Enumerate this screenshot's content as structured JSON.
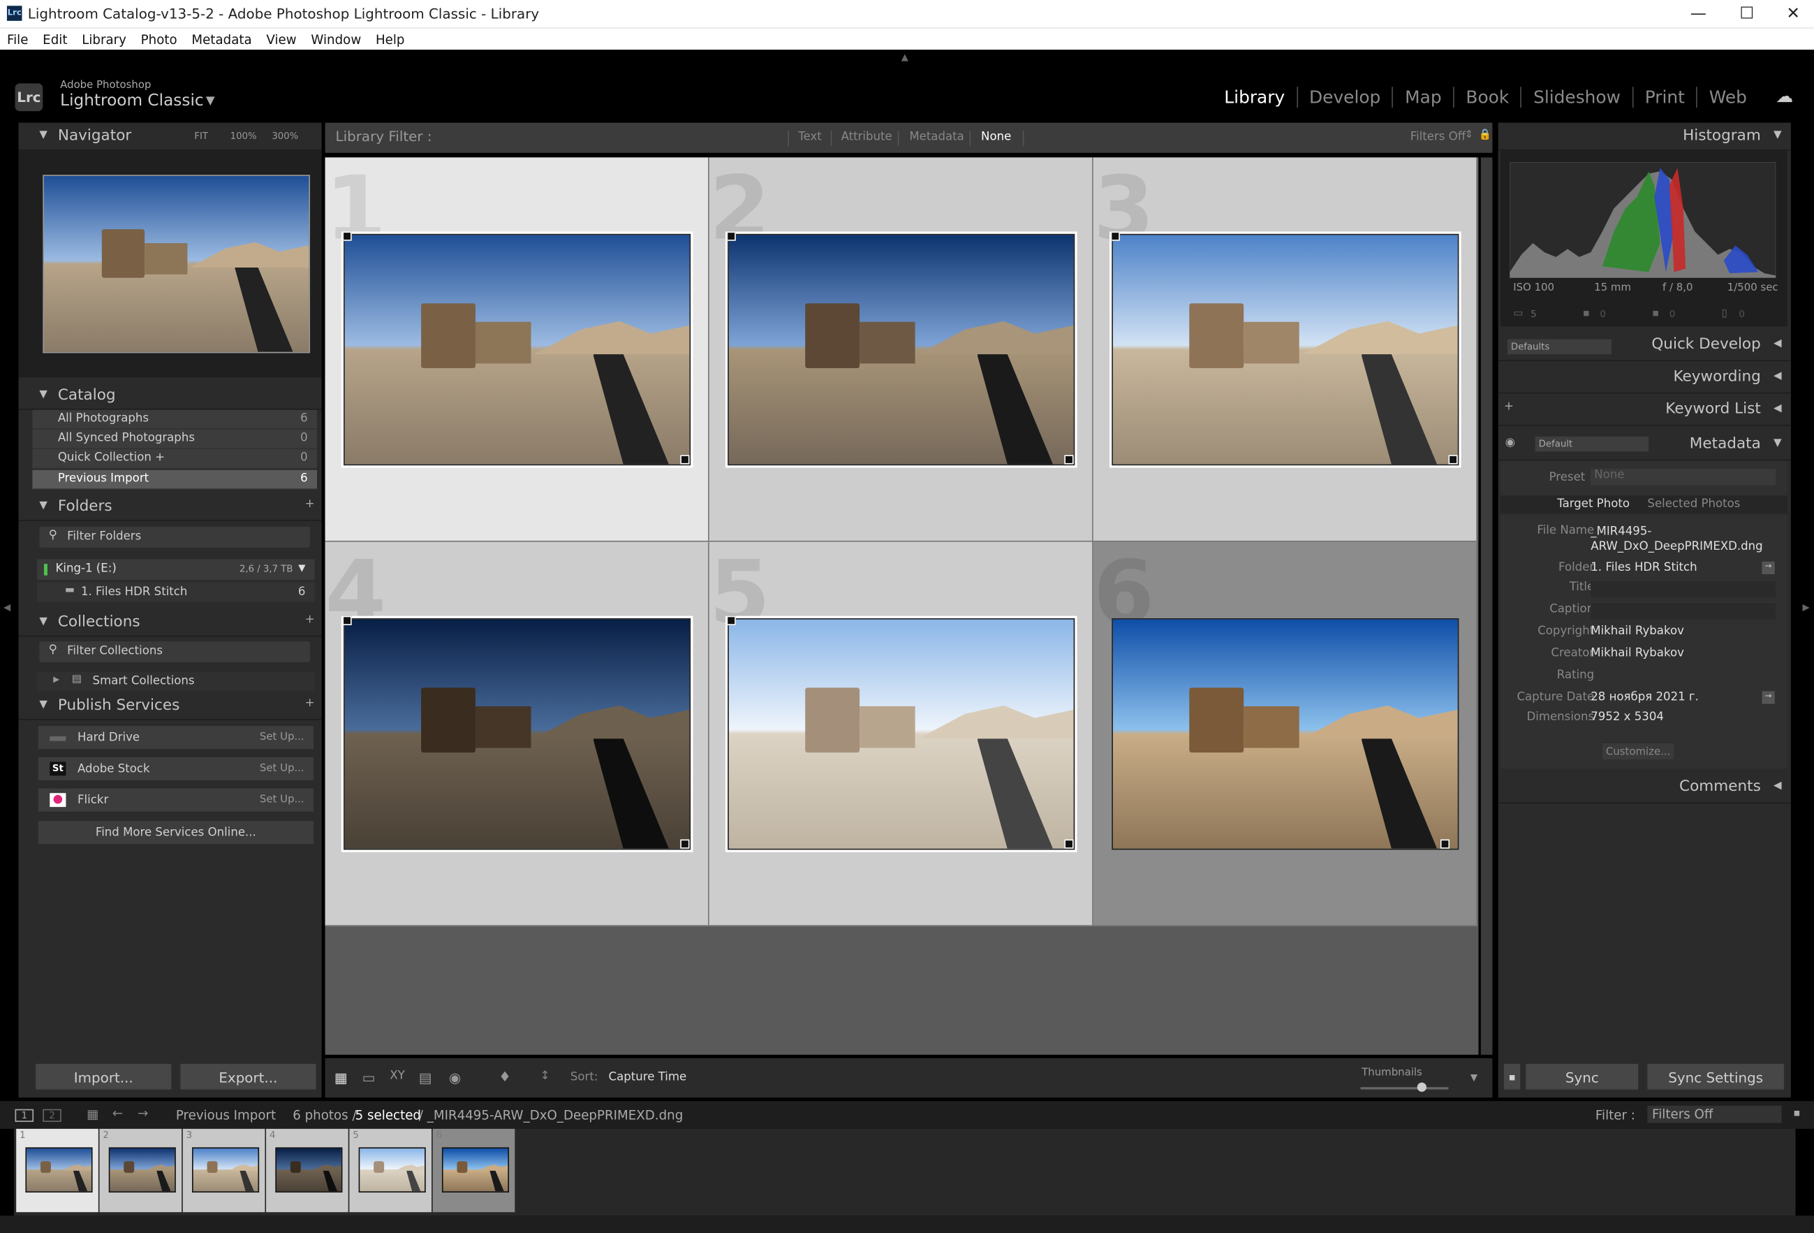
{
  "window": {
    "title": "Lightroom Catalog-v13-5-2 - Adobe Photoshop Lightroom Classic - Library",
    "app_icon_label": "Lrc",
    "minimize": "—",
    "maximize": "☐",
    "close": "✕"
  },
  "menu": [
    "File",
    "Edit",
    "Library",
    "Photo",
    "Metadata",
    "View",
    "Window",
    "Help"
  ],
  "identity": {
    "brand_top": "Adobe Photoshop",
    "brand": "Lightroom Classic",
    "logo": "Lrc"
  },
  "modules": [
    "Library",
    "Develop",
    "Map",
    "Book",
    "Slideshow",
    "Print",
    "Web"
  ],
  "navigator": {
    "title": "Navigator",
    "fit": "FIT",
    "z1": "100%",
    "z2": "300%"
  },
  "catalog": {
    "title": "Catalog",
    "items": [
      {
        "label": "All Photographs",
        "count": "6"
      },
      {
        "label": "All Synced Photographs",
        "count": "0"
      },
      {
        "label": "Quick Collection  +",
        "count": "0"
      },
      {
        "label": "Previous Import",
        "count": "6"
      }
    ]
  },
  "folders": {
    "title": "Folders",
    "filter": "Filter Folders",
    "volume": "King-1 (E:)",
    "volume_size": "2,6 / 3,7 TB",
    "folder": "1. Files HDR Stitch",
    "folder_count": "6"
  },
  "collections": {
    "title": "Collections",
    "filter": "Filter Collections",
    "smart": "Smart Collections"
  },
  "publish": {
    "title": "Publish Services",
    "items": [
      {
        "label": "Hard Drive",
        "action": "Set Up..."
      },
      {
        "label": "Adobe Stock",
        "action": "Set Up..."
      },
      {
        "label": "Flickr",
        "action": "Set Up..."
      }
    ],
    "find_more": "Find More Services Online..."
  },
  "buttons": {
    "import": "Import...",
    "export": "Export...",
    "sync": "Sync",
    "sync_settings": "Sync Settings"
  },
  "library_filter": {
    "label": "Library Filter :",
    "tabs": [
      "Text",
      "Attribute",
      "Metadata",
      "None"
    ],
    "active": "None",
    "filters_off": "Filters Off"
  },
  "grid": {
    "cells": [
      "1",
      "2",
      "3",
      "4",
      "5",
      "6"
    ]
  },
  "toolbar": {
    "sort_label": "Sort:",
    "sort_value": "Capture Time",
    "thumbnails": "Thumbnails"
  },
  "filmstrip_bar": {
    "page1": "1",
    "page2": "2",
    "source": "Previous Import",
    "count": "6 photos /",
    "selected": "5 selected",
    "file": "/ _MIR4495-ARW_DxO_DeepPRIMEXD.dng",
    "filter_label": "Filter :",
    "filter_value": "Filters Off"
  },
  "histogram": {
    "title": "Histogram",
    "iso": "ISO 100",
    "focal": "15 mm",
    "aperture": "f / 8,0",
    "shutter": "1/500 sec",
    "tool_count": "5",
    "tool_zero": "0"
  },
  "quick_develop": {
    "title": "Quick Develop",
    "preset": "Defaults"
  },
  "keywording": {
    "title": "Keywording"
  },
  "keyword_list": {
    "title": "Keyword List"
  },
  "metadata": {
    "title": "Metadata",
    "preset_dropdown": "Default",
    "preset_label": "Preset",
    "preset_value": "None",
    "tab_target": "Target Photo",
    "tab_selected": "Selected Photos",
    "fields": [
      {
        "key": "File Name",
        "value": "_MIR4495-ARW_DxO_DeepPRIMEXD.dng"
      },
      {
        "key": "Folder",
        "value": "1. Files HDR Stitch"
      },
      {
        "key": "Title",
        "value": ""
      },
      {
        "key": "Caption",
        "value": ""
      },
      {
        "key": "Copyright",
        "value": "Mikhail Rybakov"
      },
      {
        "key": "Creator",
        "value": "Mikhail Rybakov"
      },
      {
        "key": "Rating",
        "value": ""
      },
      {
        "key": "Capture Date",
        "value": "28 ноября 2021 г."
      },
      {
        "key": "Dimensions",
        "value": "7952 x 5304"
      }
    ],
    "customize": "Customize..."
  },
  "comments": {
    "title": "Comments"
  },
  "colors": {
    "panel": "#2b2b2b",
    "accent": "#ffffff",
    "grid": "#5a5a5a"
  }
}
